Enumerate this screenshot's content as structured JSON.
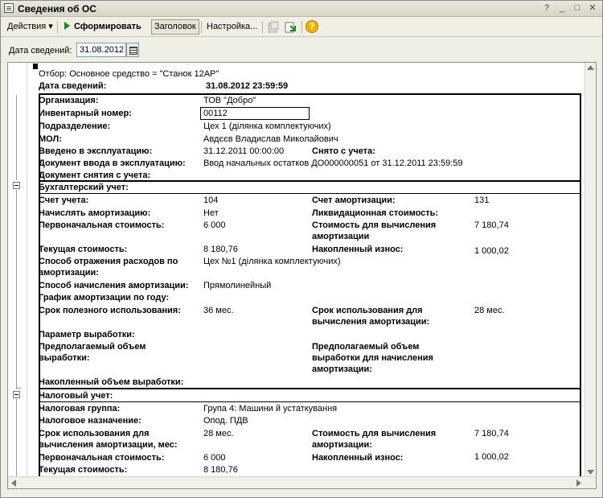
{
  "window": {
    "title": "Сведения об ОС"
  },
  "toolbar": {
    "actions_label": "Действия",
    "generate_label": "Сформировать",
    "header_label": "Заголовок",
    "settings_label": "Настройка...",
    "help_glyph": "?"
  },
  "datebar": {
    "label": "Дата сведений:",
    "value": "31.08.2012"
  },
  "report": {
    "filter": "Отбор: Основное средство = \"Станок 12АР\"",
    "date_label": "Дата сведений:",
    "date_value": "31.08.2012 23:59:59",
    "general": {
      "org_label": "Организация:",
      "org_value": "ТОВ \"Добро\"",
      "inv_label": "Инвентарный номер:",
      "inv_value": "00112",
      "dept_label": "Подразделение:",
      "dept_value": "Цех 1 (ділянка комплектуючих)",
      "mol_label": "МОЛ:",
      "mol_value": "Авдєєв Владислав Миколайович",
      "commission_label": "Введено в эксплуатацию:",
      "commission_value": "31.12.2011 00:00:00",
      "removed_label": "Снято с учета:",
      "doc_in_label": "Документ ввода в эксплуатацию:",
      "doc_in_value": "Ввод начальных остатков ДО000000051 от 31.12.2011 23:59:59",
      "doc_out_label": "Документ снятия с учета:"
    },
    "accounting": {
      "section_title": "Бухгалтерский учет:",
      "account_label": "Счет учета:",
      "account_value": "104",
      "amort_account_label": "Счет амортизации:",
      "amort_account_value": "131",
      "charge_label": "Начислять амортизацию:",
      "charge_value": "Нет",
      "liquid_label": "Ликвидационная стоимость:",
      "initial_label": "Первоначальная стоимость:",
      "initial_value": "6 000",
      "amort_base_label_1": "Стоимость для вычисления",
      "amort_base_label_2": "амортизации",
      "amort_base_value": "7 180,74",
      "current_label": "Текущая стоимость:",
      "current_value": "8 180,76",
      "accum_label": "Накопленный износ:",
      "accum_value": "1 000,02",
      "expense_label_1": "Способ отражения расходов по",
      "expense_label_2": "амортизации:",
      "expense_value": "Цех №1 (ділянка комплектуючих)",
      "method_label": "Способ начисления амортизации:",
      "method_value": "Прямолинейный",
      "schedule_label": "График амортизации по году:",
      "life_label": "Срок полезного использования:",
      "life_value": "36 мес.",
      "life_calc_label_1": "Срок использования для",
      "life_calc_label_2": "вычисления амортизации:",
      "life_calc_value": "28 мес.",
      "output_param_label": "Параметр выработки:",
      "expected_output_label_1": "Предполагаемый объем",
      "expected_output_label_2": "выработки:",
      "expected_output_amort_label_1": "Предполагаемый объем",
      "expected_output_amort_label_2": "выработки для начисления",
      "expected_output_amort_label_3": "амортизации:",
      "accum_output_label": "Накопленный объем выработки:"
    },
    "tax": {
      "section_title": "Налоговый учет:",
      "group_label": "Налоговая группа:",
      "group_value": "Група 4: Машини й устаткування",
      "purpose_label": "Налоговое назначение:",
      "purpose_value": "Опод. ПДВ",
      "life_label_1": "Срок использования для",
      "life_label_2": "вычисления амортизации, мес:",
      "life_value": "28 мес.",
      "base_label_1": "Стоимость для вычисления",
      "base_label_2": "амортизации:",
      "base_value": "7 180,74",
      "initial_label": "Первоначальная стоимость:",
      "initial_value": "6 000",
      "accum_label": "Накопленный износ:",
      "accum_value": "1 000,02",
      "current_label": "Текущая стоимость:",
      "current_value": "8 180,76"
    }
  }
}
